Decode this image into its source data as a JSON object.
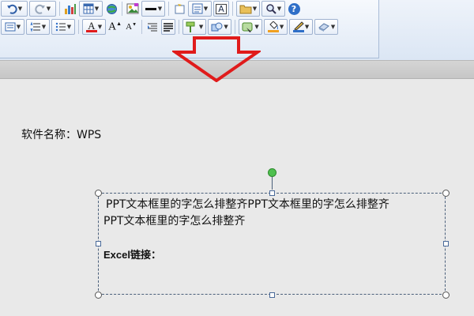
{
  "toolbar": {
    "row1": [
      "undo-icon",
      "redo-icon",
      "chart-icon",
      "table-icon",
      "globe-icon",
      "picture-icon",
      "line-icon",
      "new-slide-icon",
      "layout-icon",
      "textbox-icon",
      "folder-icon",
      "zoom-icon",
      "help-icon"
    ],
    "row2": [
      "bullets-icon",
      "numbering-icon",
      "list-icon",
      "font-color-icon",
      "grow-font-icon",
      "shrink-font-icon",
      "align-left-icon",
      "align-justify-icon",
      "shape-fill-icon",
      "shape-outline-icon",
      "effects-icon",
      "fill-bucket-icon",
      "pen-icon",
      "eraser-icon"
    ],
    "font_color_glyph": "A",
    "grow_glyph": "A",
    "shrink_glyph": "A",
    "textbox_glyph": "A",
    "help_glyph": "?"
  },
  "annotation": {
    "arrow_color": "#e01b1b"
  },
  "document": {
    "software_label": "软件名称：WPS",
    "textbox_line1": "PPT文本框里的字怎么排整齐PPT文本框里的字怎么排整齐",
    "textbox_line2": "PPT文本框里的字怎么排整齐",
    "excel_link_label": "Excel链接："
  },
  "colors": {
    "selection_border": "#4a5f7a",
    "rotate_handle": "#4fc04f",
    "background": "#e9e9e9"
  }
}
